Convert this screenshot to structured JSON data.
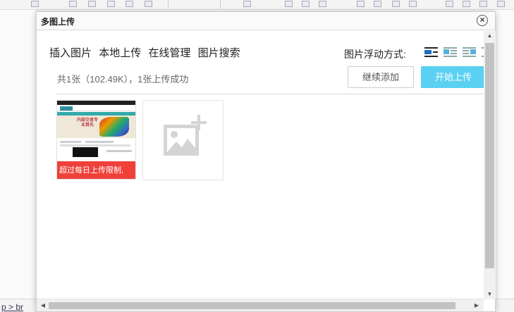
{
  "dialog": {
    "title": "多图上传",
    "close_glyph": "×"
  },
  "tabs": [
    {
      "label": "插入图片"
    },
    {
      "label": "本地上传"
    },
    {
      "label": "在线管理"
    },
    {
      "label": "图片搜索"
    }
  ],
  "float": {
    "label": "图片浮动方式:",
    "options": [
      "none",
      "left",
      "right",
      "center"
    ],
    "selected": "none"
  },
  "upload": {
    "summary": "共1张（102.49K），1张上传成功",
    "continue_label": "继续添加",
    "start_label": "开始上传",
    "thumbnail_error": "超过每日上传限制,",
    "thumbnail_banner_text": "内部交易专业首先"
  },
  "status_bar": {
    "path": "p > br"
  },
  "colors": {
    "primary_button": "#5ad0f2",
    "error_overlay": "#f0403a"
  },
  "icons": {
    "close": "close-icon",
    "add_image": "add-image-icon",
    "float_none": "float-none-icon",
    "float_left": "float-left-icon",
    "float_right": "float-right-icon",
    "float_center": "float-center-icon"
  }
}
